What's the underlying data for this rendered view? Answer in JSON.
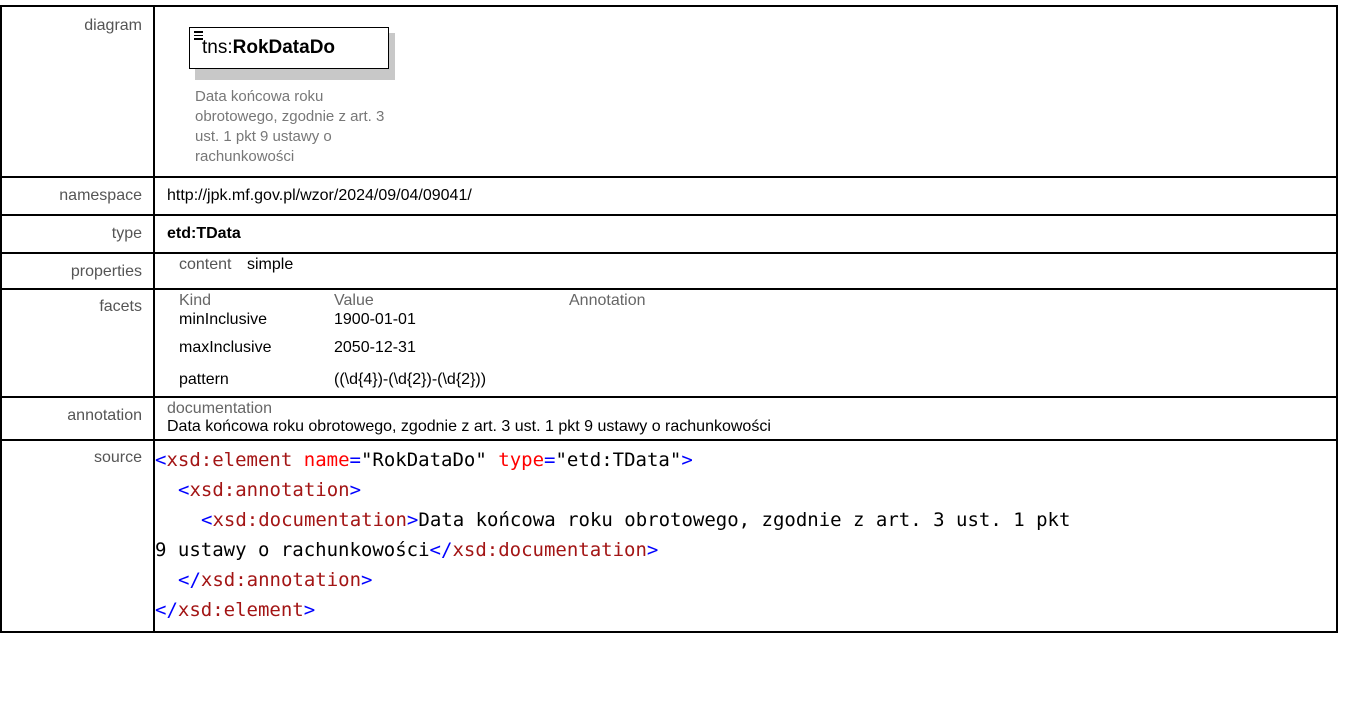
{
  "diagram": {
    "label": "diagram",
    "element_prefix": "tns:",
    "element_name": "RokDataDo",
    "doc_lines": [
      "Data końcowa roku",
      "obrotowego, zgodnie z art. 3",
      "ust. 1 pkt 9 ustawy o",
      "rachunkowości"
    ]
  },
  "namespace": {
    "label": "namespace",
    "value": "http://jpk.mf.gov.pl/wzor/2024/09/04/09041/"
  },
  "type": {
    "label": "type",
    "value": "etd:TData"
  },
  "properties": {
    "label": "properties",
    "key": "content",
    "value": "simple"
  },
  "facets": {
    "label": "facets",
    "headers": [
      "Kind",
      "Value",
      "Annotation"
    ],
    "rows": [
      {
        "kind": "minInclusive",
        "value": "1900-01-01",
        "annotation": ""
      },
      {
        "kind": "maxInclusive",
        "value": "2050-12-31",
        "annotation": ""
      },
      {
        "kind": "pattern",
        "value": "((\\d{4})-(\\d{2})-(\\d{2}))",
        "annotation": ""
      }
    ]
  },
  "annotation": {
    "label": "annotation",
    "key": "documentation",
    "value": "Data końcowa roku obrotowego, zgodnie z art. 3 ust. 1 pkt 9 ustawy o rachunkowości"
  },
  "source": {
    "label": "source",
    "element_tag": "xsd:element",
    "attr_name_key": "name",
    "attr_name_val": "\"RokDataDo\"",
    "attr_type_key": "type",
    "attr_type_val": "\"etd:TData\"",
    "annotation_tag": "xsd:annotation",
    "documentation_tag": "xsd:documentation",
    "documentation_text_1": "Data końcowa roku obrotowego, zgodnie z art. 3 ust. 1 pkt",
    "documentation_text_2": "9 ustawy o rachunkowości"
  }
}
